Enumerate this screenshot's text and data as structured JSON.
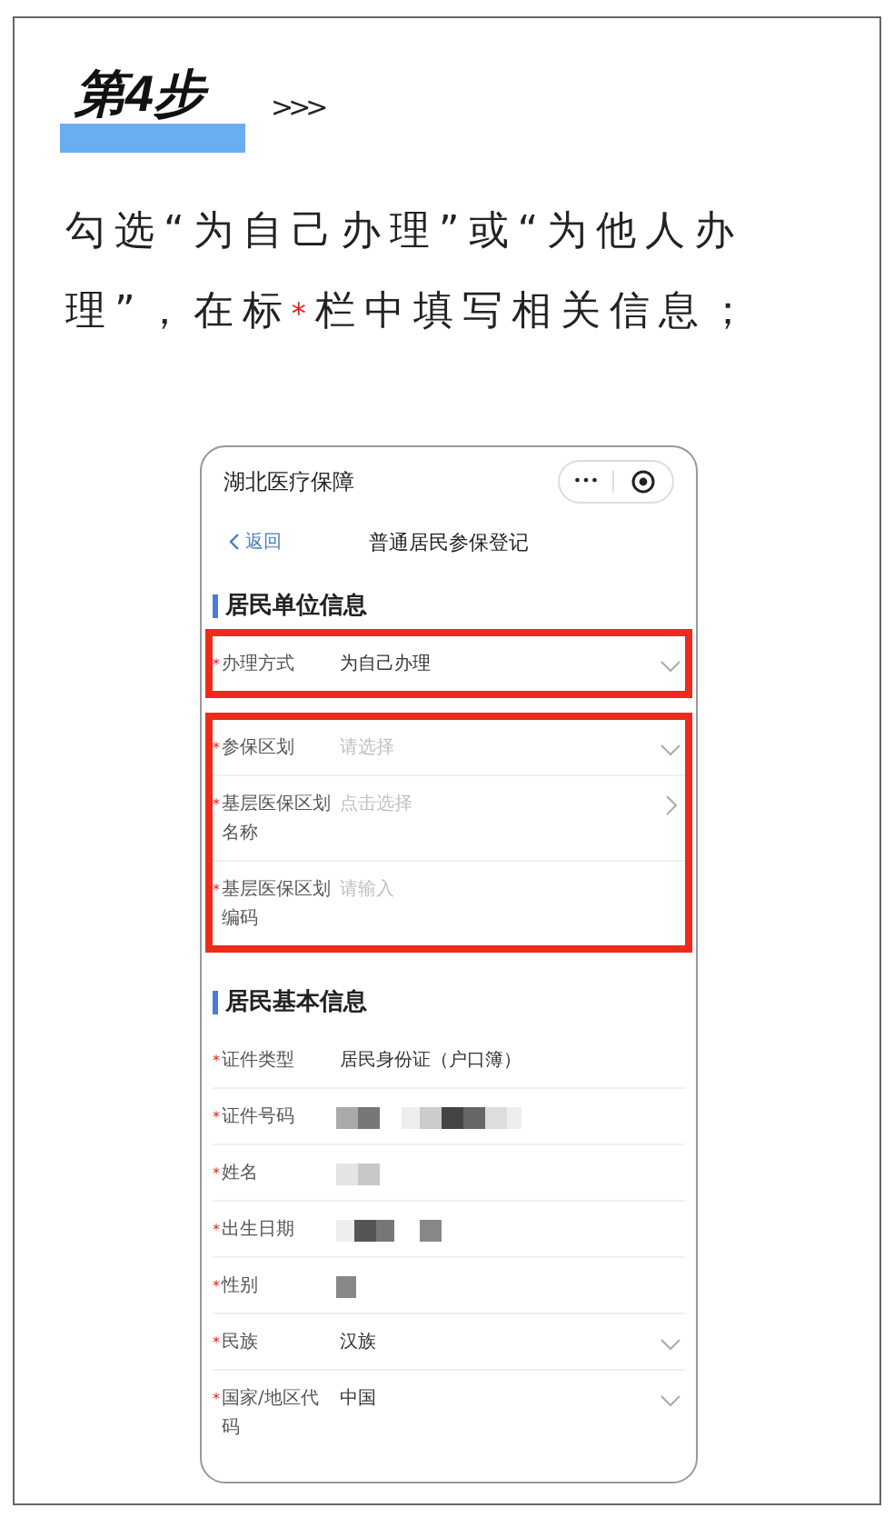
{
  "step": {
    "title": "第4步",
    "arrows": ">>>"
  },
  "instruction": {
    "before": "勾选“为自己办理”或“为他人办理”，在标",
    "mark": "*",
    "after": "栏中填写相关信息；"
  },
  "phone": {
    "app_title": "湖北医疗保障",
    "capsule": {
      "more": "•••"
    },
    "nav": {
      "back": "返回",
      "title": "普通居民参保登记"
    },
    "sections": [
      {
        "title": "居民单位信息",
        "groups": [
          {
            "highlighted": true,
            "rows": [
              {
                "label": "办理方式",
                "required": true,
                "kind": "value",
                "value": "为自己办理",
                "dropdown": true,
                "arrow": false
              }
            ]
          },
          {
            "highlighted": true,
            "rows": [
              {
                "label": "参保区划",
                "required": true,
                "kind": "placeholder",
                "placeholder": "请选择",
                "dropdown": true,
                "arrow": false
              },
              {
                "label": "基层医保区划名称",
                "required": true,
                "kind": "placeholder",
                "placeholder": "点击选择",
                "dropdown": false,
                "arrow": true
              },
              {
                "label": "基层医保区划编码",
                "required": true,
                "kind": "placeholder",
                "placeholder": "请输入",
                "dropdown": false,
                "arrow": false
              }
            ]
          }
        ]
      },
      {
        "title": "居民基本信息",
        "groups": [
          {
            "highlighted": false,
            "rows": [
              {
                "label": "证件类型",
                "required": true,
                "kind": "value",
                "value": "居民身份证（户口簿）",
                "dropdown": false,
                "arrow": false
              },
              {
                "label": "证件号码",
                "required": true,
                "kind": "masked",
                "dropdown": false,
                "arrow": false
              },
              {
                "label": "姓名",
                "required": true,
                "kind": "masked",
                "dropdown": false,
                "arrow": false
              },
              {
                "label": "出生日期",
                "required": true,
                "kind": "masked",
                "dropdown": false,
                "arrow": false
              },
              {
                "label": "性别",
                "required": true,
                "kind": "masked",
                "dropdown": false,
                "arrow": false
              },
              {
                "label": "民族",
                "required": true,
                "kind": "value",
                "value": "汉族",
                "dropdown": true,
                "arrow": false
              },
              {
                "label": "国家/地区代码",
                "required": true,
                "kind": "value",
                "value": "中国",
                "dropdown": true,
                "arrow": false
              }
            ]
          }
        ]
      }
    ]
  }
}
